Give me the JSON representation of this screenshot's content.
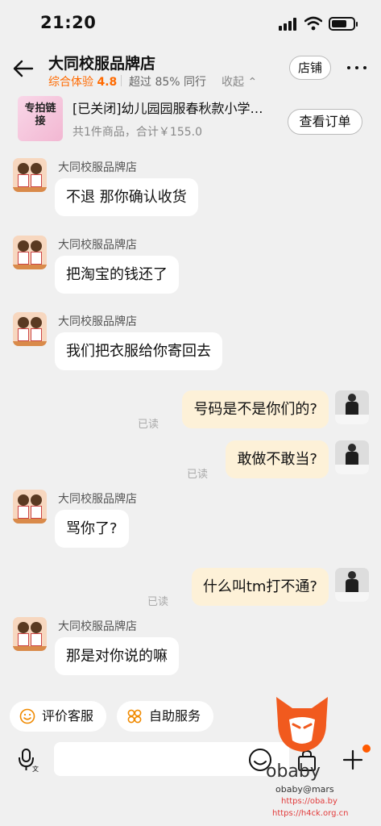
{
  "status_bar": {
    "time": "21:20",
    "signal_icon": "cellular-signal-icon",
    "wifi_icon": "wifi-icon",
    "battery_icon": "battery-icon"
  },
  "header": {
    "back_icon": "arrow-left-icon",
    "shop_name": "大同校服品牌店",
    "rating_label": "综合体验",
    "rating_value": "4.8",
    "beat_text": "超过 85% 同行",
    "collapse_text": "收起 ⌃",
    "store_button": "店铺",
    "more_icon": "more-dots-icon"
  },
  "order": {
    "thumb_text": "专拍链接",
    "title": "[已关闭]幼儿园园服春秋款小学…",
    "summary": "共1件商品，合计￥155.0",
    "view_button": "查看订单"
  },
  "messages": [
    {
      "side": "in",
      "sender": "大同校服品牌店",
      "text": "不退 那你确认收货"
    },
    {
      "side": "in",
      "sender": "大同校服品牌店",
      "text": "把淘宝的钱还了"
    },
    {
      "side": "in",
      "sender": "大同校服品牌店",
      "text": "我们把衣服给你寄回去"
    },
    {
      "side": "out",
      "text": "号码是不是你们的?",
      "read": "已读"
    },
    {
      "side": "out",
      "text": "敢做不敢当?",
      "read": "已读"
    },
    {
      "side": "in",
      "sender": "大同校服品牌店",
      "text": "骂你了?"
    },
    {
      "side": "out",
      "text": "什么叫tm打不通?",
      "read": "已读"
    },
    {
      "side": "in",
      "sender": "大同校服品牌店",
      "text": "那是对你说的嘛"
    }
  ],
  "quick_actions": [
    {
      "label": "评价客服",
      "icon": "smile-icon"
    },
    {
      "label": "自助服务",
      "icon": "flower-grid-icon"
    }
  ],
  "input_bar": {
    "voice_icon": "microphone-icon",
    "emoji_icon": "emoji-icon",
    "shop_icon": "shopping-bag-icon",
    "plus_icon": "plus-icon"
  },
  "watermark": {
    "name": "obaby",
    "handle": "obaby@mars",
    "url1": "https://oba.by",
    "url2": "https://h4ck.org.cn"
  },
  "colors": {
    "accent": "#ff6a00",
    "outgoing_bubble": "#fdf1d8",
    "background": "#f0f0f0"
  }
}
